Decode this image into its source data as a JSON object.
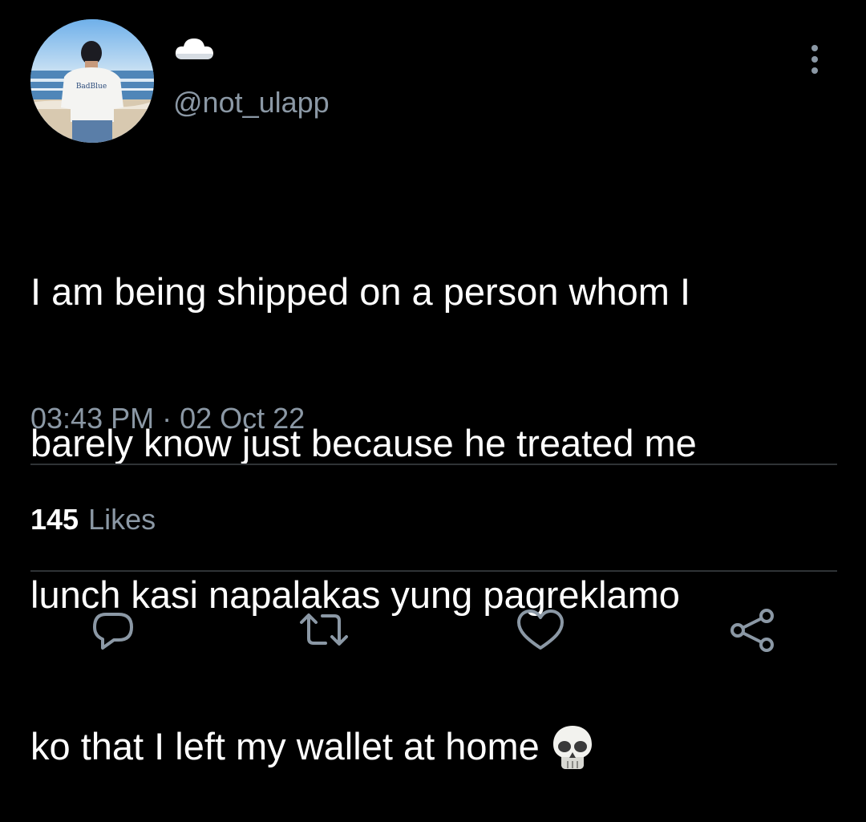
{
  "tweet": {
    "display_name_icon": "cloud-icon",
    "handle": "@not_ulapp",
    "avatar_shirt_text": "BadBlue",
    "text_lines": [
      "I am being shipped on a person whom I",
      "barely know just because he treated me",
      "lunch kasi napalakas yung pagreklamo",
      "ko that I left my wallet at home"
    ],
    "emoji": "skull-icon",
    "timestamp": "03:43 PM · 02 Oct 22",
    "likes_count": "145",
    "likes_label": "Likes"
  },
  "actions": {
    "reply_icon": "reply-icon",
    "retweet_icon": "retweet-icon",
    "like_icon": "heart-icon",
    "share_icon": "share-icon",
    "more_icon": "more-vertical-icon"
  },
  "colors": {
    "background": "#000000",
    "text_primary": "#ffffff",
    "text_secondary": "#8b98a5",
    "divider": "#2f3336"
  }
}
